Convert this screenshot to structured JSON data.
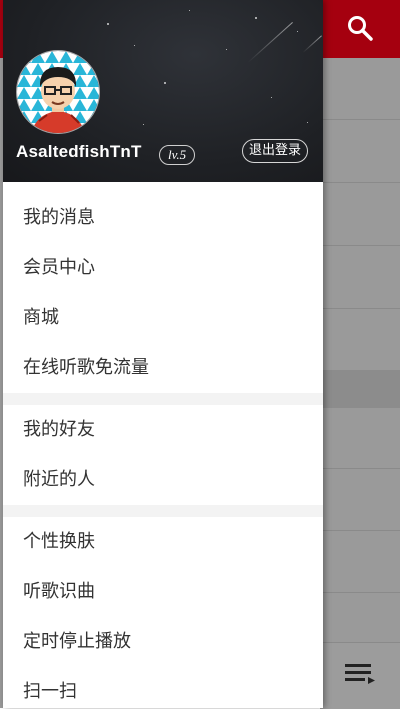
{
  "colors": {
    "topbar": "#a5000f",
    "header_bg": "#1f2125",
    "menu_text": "#333333",
    "divider": "#f3f3f3"
  },
  "background_app": {
    "search_icon": "search-icon",
    "playlist_icon": "playlist-icon"
  },
  "drawer": {
    "user": {
      "avatar_icon": "avatar",
      "name": "AsaltedfishTnT",
      "level": "lv.5",
      "logout_label": "退出登录"
    },
    "groups": [
      {
        "items": [
          {
            "label": "我的消息"
          },
          {
            "label": "会员中心"
          },
          {
            "label": "商城"
          },
          {
            "label": "在线听歌免流量"
          }
        ]
      },
      {
        "items": [
          {
            "label": "我的好友"
          },
          {
            "label": "附近的人"
          }
        ]
      },
      {
        "items": [
          {
            "label": "个性换肤"
          },
          {
            "label": "听歌识曲"
          },
          {
            "label": "定时停止播放"
          },
          {
            "label": "扫一扫"
          }
        ]
      }
    ]
  }
}
